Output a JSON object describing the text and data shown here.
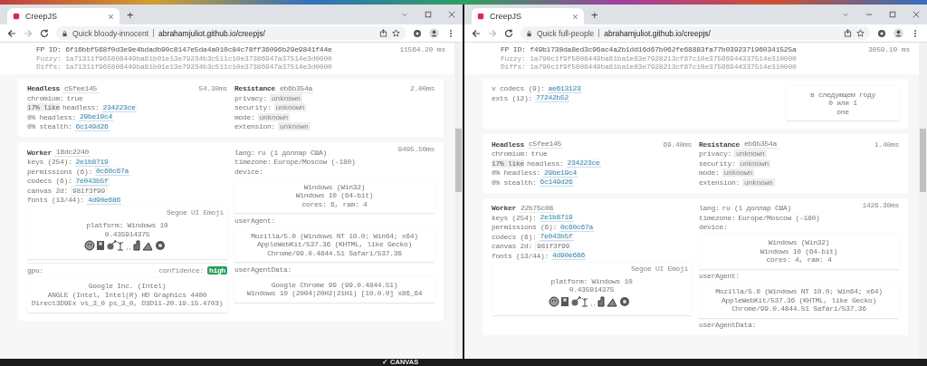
{
  "windows": [
    {
      "tab_title": "CreepJS",
      "new_tab": "+",
      "site_label": "Quick bloody-innocent",
      "url": "abrahamjuliot.github.io/creepjs/",
      "fingerprint": {
        "fp_id": "FP ID: 6f16bbf568f0d3e9e4bdadb90c8147e5da4a010c84c78ff36096b29e9841f44e",
        "fuzzy": "Fuzzy: 1a71311f965808449ba81b01e13e79234b3c511c10e37386947a37514e3d0000",
        "diffs": "Diffs: 1a71311f965808449ba81b01e13e79234b3c511c10e37386947a37514e3d0000",
        "time": "11564.20 ms"
      },
      "cards": [
        {
          "columns": [
            [
              {
                "kind": "heading",
                "label": "Headless",
                "hash": "c5fee145",
                "time": "54.30ms"
              },
              {
                "kind": "field",
                "label": "chromium:",
                "value": "true"
              },
              {
                "kind": "link",
                "tag": "17% like",
                "label": "headless:",
                "value": "234223ce"
              },
              {
                "kind": "link",
                "label": "0% headless:",
                "value": "29be19c4"
              },
              {
                "kind": "link",
                "label": "0% stealth:",
                "value": "6c149d26"
              }
            ],
            [
              {
                "kind": "heading",
                "label": "Resistance",
                "hash": "eb6b354a",
                "time": "2.00ms"
              },
              {
                "kind": "unknown",
                "label": "privacy:",
                "value": "unknown"
              },
              {
                "kind": "unknown",
                "label": "security:",
                "value": "unknown"
              },
              {
                "kind": "unknown",
                "label": "mode:",
                "value": "unknown"
              },
              {
                "kind": "unknown",
                "label": "extension:",
                "value": "unknown"
              }
            ]
          ]
        },
        {
          "time": "9495.50ms",
          "columns": [
            [
              {
                "kind": "heading",
                "label": "Worker",
                "hash": "18dc2240"
              },
              {
                "kind": "link",
                "label": "keys (254):",
                "value": "2e1b8719"
              },
              {
                "kind": "link",
                "label": "permissions (6):",
                "value": "0c60c67a"
              },
              {
                "kind": "link",
                "label": "codecs (6):",
                "value": "7e043b5f"
              },
              {
                "kind": "hash",
                "label": "canvas 2d:",
                "value": "981f3f99"
              },
              {
                "kind": "link",
                "label": "fonts (13/44):",
                "value": "4d90e686"
              },
              {
                "kind": "panel",
                "caption": "Segoe UI Emoji",
                "lines": [
                  "platform: Windows 10",
                  "0.435914375"
                ],
                "emoji": true
              },
              {
                "kind": "gpu",
                "label": "gpu:",
                "confidence_label": "confidence:",
                "badge": "high"
              },
              {
                "kind": "panel",
                "lines": [
                  "Google Inc. (Intel)",
                  "ANGLE (Intel, Intel(R) HD Graphics 4400",
                  "Direct3D9Ex vs_3_0 ps_3_0, D3D11-20.19.15.4703)"
                ]
              }
            ],
            [
              {
                "kind": "field",
                "label": "lang:",
                "value": "ru (1 доллар США)"
              },
              {
                "kind": "field",
                "label": "timezone:",
                "value": "Europe/Moscow (-180)"
              },
              {
                "kind": "label",
                "text": "device:"
              },
              {
                "kind": "panel",
                "lines": [
                  "Windows (Win32)",
                  "Windows 10 (64-bit)",
                  "cores: 6, ram: 4"
                ]
              },
              {
                "kind": "label",
                "text": "userAgent:"
              },
              {
                "kind": "panel",
                "lines": [
                  "Mozilla/5.0 (Windows NT 10.0; Win64; x64)",
                  "AppleWebKit/537.36 (KHTML, like Gecko)",
                  "Chrome/99.0.4844.51 Safari/537.36"
                ]
              },
              {
                "kind": "label",
                "text": "userAgentData:"
              },
              {
                "kind": "panel",
                "lines": [
                  "Google Chrome 99 (99.0.4844.51)",
                  "Windows 10 (2004|20H2|21H1) [10.0.0] x86_64"
                ]
              }
            ]
          ]
        }
      ],
      "status": "✓ CANVAS"
    },
    {
      "tab_title": "CreepJS",
      "new_tab": "+",
      "site_label": "Quick full-people",
      "url": "abrahamjuliot.github.io/creepjs/",
      "fingerprint": {
        "fp_id": "FP ID: f49b1738da8ed3c96ac4a2b1dd16d67b062fe68883fa77b0392371960341525a",
        "fuzzy": "Fuzzy: 1a790c1f9f5808449ba81ba1e83e7928213cf87c10e37586944337514e310000",
        "diffs": "Diffs: 1a790c1f9f5808449ba81ba1e83e7928213cf87c10e37586944337514e310000",
        "time": "3059.10 ms"
      },
      "cards": [
        {
          "columns": [
            [
              {
                "kind": "link",
                "label": "v codecs (9):",
                "value": "ae613123"
              },
              {
                "kind": "link",
                "label": "exts (12):",
                "value": "77242b52"
              }
            ],
            [
              {
                "kind": "panel",
                "narrow": true,
                "lines": [
                  "в следующем году",
                  "0 или 1",
                  "one"
                ]
              }
            ]
          ]
        },
        {
          "columns": [
            [
              {
                "kind": "heading",
                "label": "Headless",
                "hash": "c5fee145",
                "time": "69.40ms"
              },
              {
                "kind": "field",
                "label": "chromium:",
                "value": "true"
              },
              {
                "kind": "link",
                "tag": "17% like",
                "label": "headless:",
                "value": "234223ce"
              },
              {
                "kind": "link",
                "label": "0% headless:",
                "value": "29be19c4"
              },
              {
                "kind": "link",
                "label": "0% stealth:",
                "value": "6c149d26"
              }
            ],
            [
              {
                "kind": "heading",
                "label": "Resistance",
                "hash": "eb6b354a",
                "time": "1.40ms"
              },
              {
                "kind": "unknown",
                "label": "privacy:",
                "value": "unknown"
              },
              {
                "kind": "unknown",
                "label": "security:",
                "value": "unknown"
              },
              {
                "kind": "unknown",
                "label": "mode:",
                "value": "unknown"
              },
              {
                "kind": "unknown",
                "label": "extension:",
                "value": "unknown"
              }
            ]
          ]
        },
        {
          "time": "1426.30ms",
          "columns": [
            [
              {
                "kind": "heading",
                "label": "Worker",
                "hash": "22b75c08"
              },
              {
                "kind": "link",
                "label": "keys (254):",
                "value": "2e1b8719"
              },
              {
                "kind": "link",
                "label": "permissions (6):",
                "value": "0c60c67a"
              },
              {
                "kind": "link",
                "label": "codecs (6):",
                "value": "7e043b5f"
              },
              {
                "kind": "hash",
                "label": "canvas 2d:",
                "value": "981f3f99"
              },
              {
                "kind": "link",
                "label": "fonts (13/44):",
                "value": "4d90e686"
              },
              {
                "kind": "panel",
                "caption": "Segoe UI Emoji",
                "lines": [
                  "platform: Windows 10",
                  "0.435914375"
                ],
                "emoji": true
              }
            ],
            [
              {
                "kind": "field",
                "label": "lang:",
                "value": "ru (1 доллар США)"
              },
              {
                "kind": "field",
                "label": "timezone:",
                "value": "Europe/Moscow (-180)"
              },
              {
                "kind": "label",
                "text": "device:"
              },
              {
                "kind": "panel",
                "lines": [
                  "Windows (Win32)",
                  "Windows 10 (64-bit)",
                  "cores: 4, ram: 4"
                ]
              },
              {
                "kind": "label",
                "text": "userAgent:"
              },
              {
                "kind": "panel",
                "lines": [
                  "Mozilla/5.0 (Windows NT 10.0; Win64; x64)",
                  "AppleWebKit/537.36 (KHTML, like Gecko)",
                  "Chrome/99.0.4844.51 Safari/537.36"
                ]
              },
              {
                "kind": "label",
                "text": "userAgentData:"
              }
            ]
          ]
        }
      ]
    }
  ]
}
